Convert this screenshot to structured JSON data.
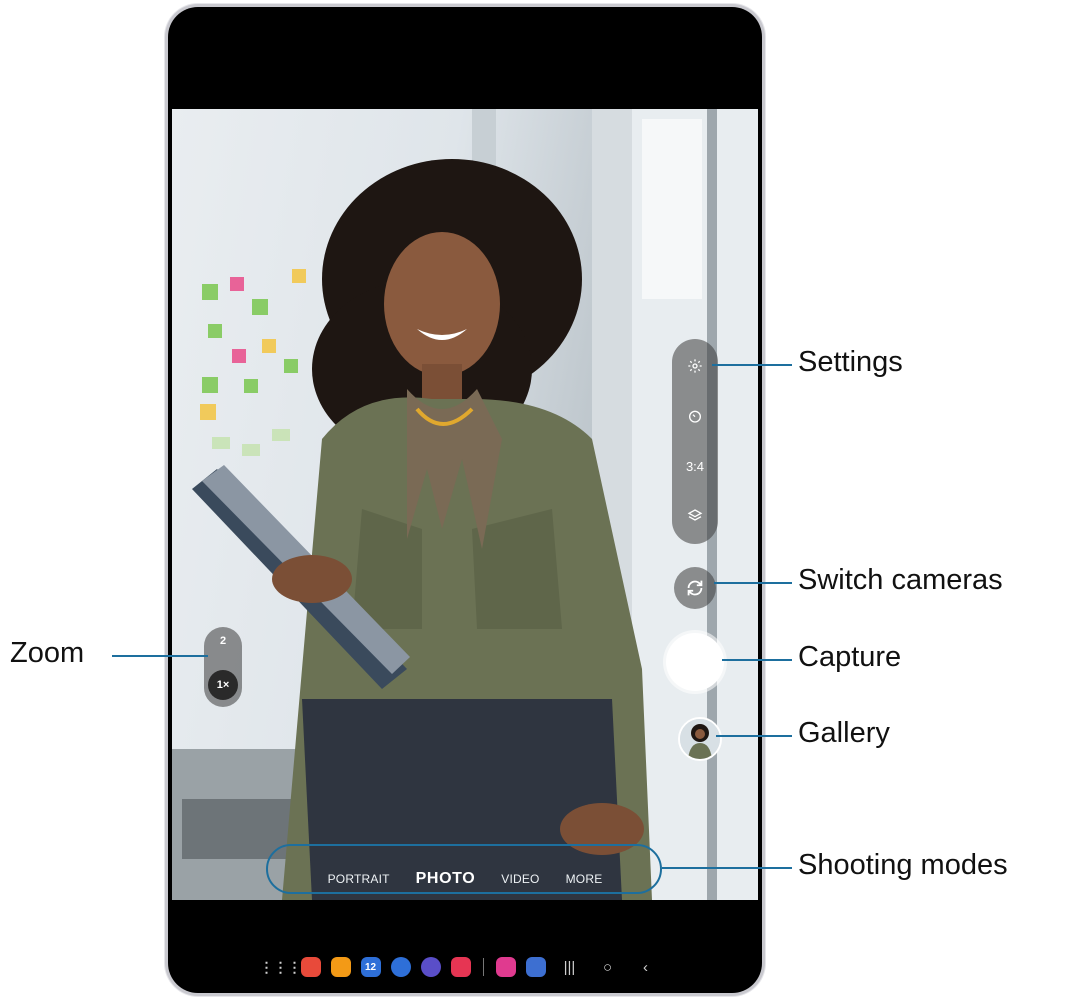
{
  "callouts": {
    "settings": "Settings",
    "switch_cameras": "Switch cameras",
    "capture": "Capture",
    "gallery": "Gallery",
    "shooting_modes": "Shooting modes",
    "zoom": "Zoom"
  },
  "zoom": {
    "option": "2",
    "selected": "1×"
  },
  "side_controls": {
    "settings_icon": "gear-icon",
    "timer_icon": "timer-icon",
    "aspect_ratio": "3:4",
    "filters_icon": "layers-icon",
    "switch_icon": "camera-switch-icon"
  },
  "modes": [
    "PORTRAIT",
    "PHOTO",
    "VIDEO",
    "MORE"
  ],
  "active_mode": "PHOTO",
  "navbar": {
    "apps": [
      {
        "icon": "apps-grid-icon"
      },
      {
        "icon": "notes-app-icon",
        "color": "#e84a3a"
      },
      {
        "icon": "files-app-icon",
        "color": "#f39a16"
      },
      {
        "icon": "calendar-app-icon",
        "color": "#2e6fd8",
        "label": "12"
      },
      {
        "icon": "messages-app-icon",
        "color": "#2e6fd8"
      },
      {
        "icon": "internet-app-icon",
        "color": "#5a4ec8"
      },
      {
        "icon": "screen-recorder-app-icon",
        "color": "#e63553"
      },
      {
        "icon": "galaxy-store-app-icon",
        "color": "#e03a8f"
      },
      {
        "icon": "settings-app-icon",
        "color": "#3d6fd1"
      }
    ],
    "recents_icon": "recents-icon",
    "home_icon": "home-icon",
    "back_icon": "back-icon"
  },
  "colors": {
    "callout_line": "#1d6f9e",
    "device_frame": "#000000"
  }
}
